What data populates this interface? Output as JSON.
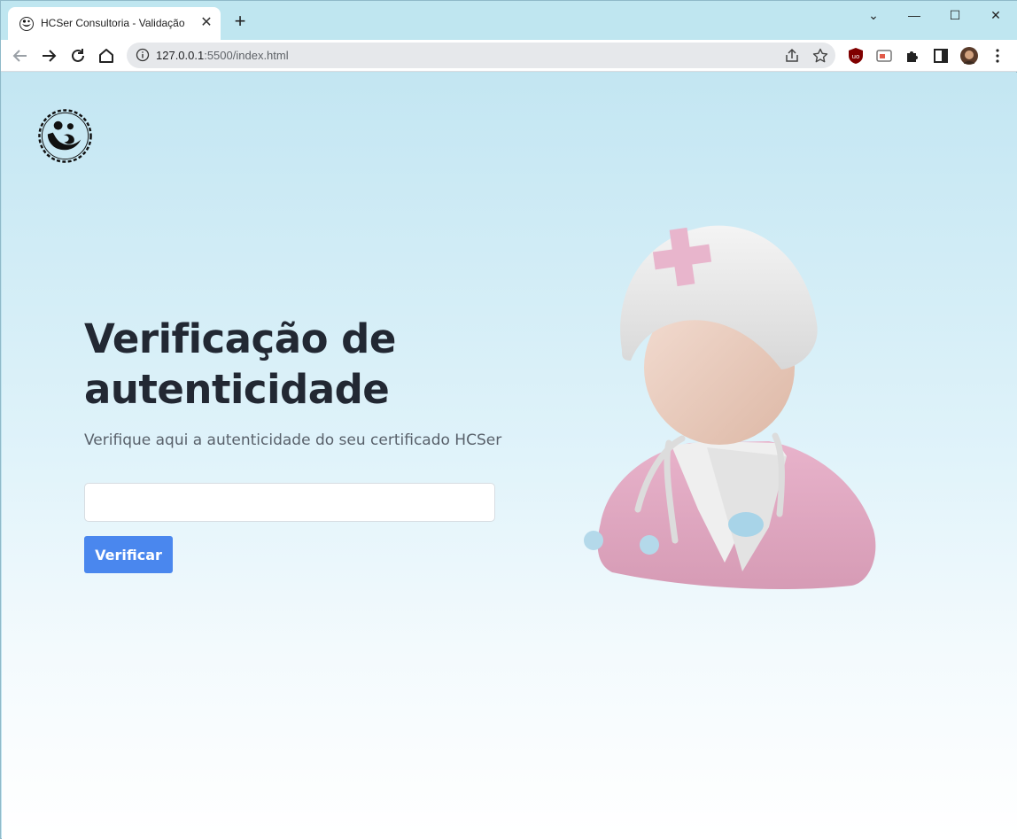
{
  "browser": {
    "tab_title": "HCSer Consultoria - Validação",
    "tab_close": "✕",
    "new_tab": "+",
    "url_host": "127.0.0.1",
    "url_path": ":5500/index.html",
    "controls": {
      "dropdown": "⌄",
      "minimize": "—",
      "maximize": "☐",
      "close": "✕"
    }
  },
  "page": {
    "headline": "Verificação de autenticidade",
    "subtitle": "Verifique aqui a autenticidade do seu certificado HCSer",
    "input": {
      "value": "",
      "placeholder": ""
    },
    "verify_button": "Verificar"
  },
  "icons": {
    "logo": "hcser-logo-icon",
    "illustration": "nurse-illustration"
  },
  "colors": {
    "accent": "#4a87ee",
    "headline": "#222833",
    "subtitle": "#59616b",
    "background_top": "#c3e6f2",
    "background_bottom": "#ffffff"
  }
}
